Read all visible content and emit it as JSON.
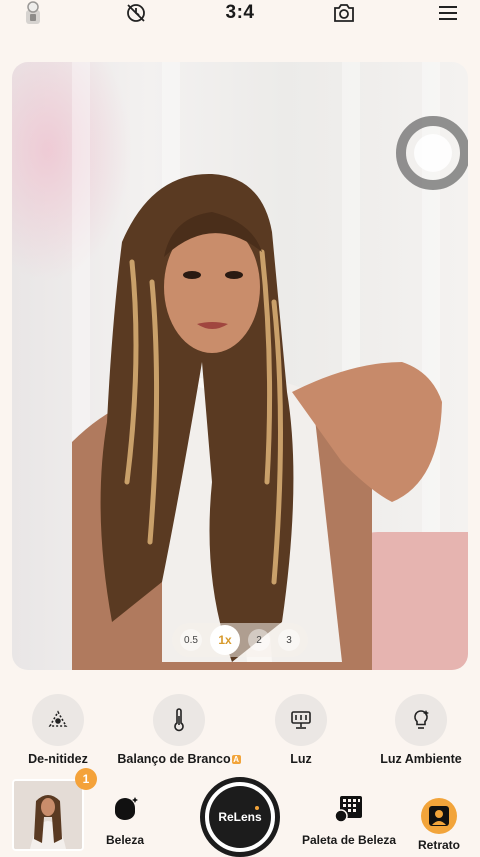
{
  "top_bar": {
    "aspect_ratio": "3:4",
    "icons": [
      "flash-icon",
      "timer-off-icon",
      "switch-camera-icon",
      "menu-icon"
    ]
  },
  "viewfinder": {
    "zoom_options": [
      "0.5",
      "1x",
      "2",
      "3"
    ],
    "zoom_active": "1x"
  },
  "tools": [
    {
      "label": "De-nitidez",
      "icon": "defocus-icon"
    },
    {
      "label": "Balanço de Branco",
      "icon": "thermometer-icon",
      "badge": "A"
    },
    {
      "label": "Luz",
      "icon": "light-panel-icon"
    },
    {
      "label": "Luz Ambiente",
      "icon": "bulb-icon"
    }
  ],
  "bottom": {
    "gallery_badge": "1",
    "beleza_label": "Beleza",
    "shutter_label": "ReLens",
    "paleta_label": "Paleta de Beleza",
    "retrato_label": "Retrato"
  },
  "colors": {
    "accent": "#f2a43a",
    "background": "#fbf5f0",
    "dark": "#1c1c1c"
  }
}
